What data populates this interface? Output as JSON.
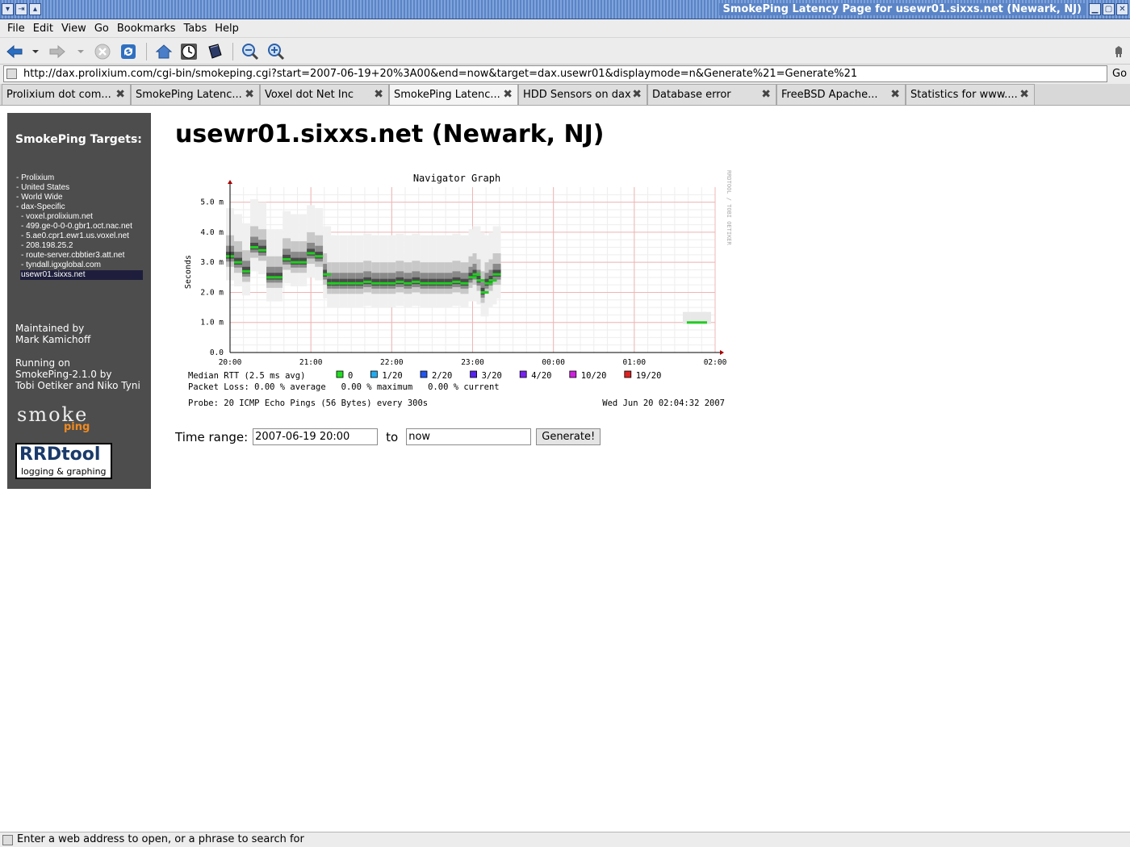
{
  "window": {
    "title": "SmokePing Latency Page for usewr01.sixxs.net (Newark, NJ)"
  },
  "menu": [
    "File",
    "Edit",
    "View",
    "Go",
    "Bookmarks",
    "Tabs",
    "Help"
  ],
  "url": {
    "value": "http://dax.prolixium.com/cgi-bin/smokeping.cgi?start=2007-06-19+20%3A00&end=now&target=dax.usewr01&displaymode=n&Generate%21=Generate%21",
    "go_label": "Go"
  },
  "tabs": [
    {
      "label": "Prolixium dot com..."
    },
    {
      "label": "SmokePing Latenc..."
    },
    {
      "label": "Voxel dot Net Inc"
    },
    {
      "label": "SmokePing Latenc..."
    },
    {
      "label": "HDD Sensors on dax"
    },
    {
      "label": "Database error"
    },
    {
      "label": "FreeBSD Apache..."
    },
    {
      "label": "Statistics for www...."
    }
  ],
  "sidebar": {
    "title": "SmokePing Targets:",
    "targets": [
      "- Prolixium",
      "- United States",
      "- World Wide",
      "- dax-Specific",
      "- voxel.prolixium.net",
      "- 499.ge-0-0-0.gbr1.oct.nac.net",
      "- 5.ae0.cpr1.ewr1.us.voxel.net",
      "- 208.198.25.2",
      "- route-server.cbbtier3.att.net",
      "- tyndall.igxglobal.com",
      "usewr01.sixxs.net"
    ],
    "maintained_label": "Maintained by",
    "maintainer": "Mark Kamichoff",
    "running_label": "Running on",
    "version": "SmokePing-2.1.0 by",
    "authors": "Tobi Oetiker and Niko Tyni",
    "smoke_logo_top": "smoke",
    "smoke_logo_bottom": "ping",
    "rrd_logo_big": "RRDtool",
    "rrd_logo_small": "logging & graphing"
  },
  "page": {
    "heading": "usewr01.sixxs.net (Newark, NJ)"
  },
  "chart_data": {
    "type": "line",
    "title": "Navigator Graph",
    "ylabel": "Seconds",
    "watermark": "RRDTOOL / TOBI OETIKER",
    "x_ticks": [
      "20:00",
      "21:00",
      "22:00",
      "23:00",
      "00:00",
      "01:00",
      "02:00"
    ],
    "y_ticks": [
      "0.0",
      "1.0 m",
      "2.0 m",
      "3.0 m",
      "4.0 m",
      "5.0 m"
    ],
    "ylim": [
      0,
      5.5
    ],
    "xlim_hours": [
      20,
      26
    ],
    "median_series": {
      "name": "Median RTT",
      "x": [
        20.0,
        20.1,
        20.2,
        20.3,
        20.4,
        20.5,
        20.6,
        20.7,
        20.8,
        20.9,
        21.0,
        21.1,
        21.2,
        21.25,
        21.3,
        21.4,
        21.5,
        21.6,
        21.7,
        21.8,
        21.9,
        22.0,
        22.1,
        22.2,
        22.3,
        22.4,
        22.5,
        22.6,
        22.7,
        22.8,
        22.9,
        23.0,
        23.05,
        23.1,
        23.15,
        23.2,
        23.25,
        23.3
      ],
      "values": [
        3.2,
        3.0,
        2.7,
        3.5,
        3.4,
        2.5,
        2.5,
        3.1,
        3.0,
        3.0,
        3.3,
        3.2,
        2.6,
        2.3,
        2.3,
        2.3,
        2.3,
        2.3,
        2.35,
        2.3,
        2.3,
        2.3,
        2.35,
        2.3,
        2.35,
        2.3,
        2.3,
        2.3,
        2.3,
        2.35,
        2.3,
        2.5,
        2.6,
        2.4,
        2.0,
        2.3,
        2.4,
        2.6
      ]
    },
    "late_series": {
      "x": [
        25.65,
        25.75,
        25.85,
        25.9
      ],
      "values": [
        1.0,
        1.0,
        1.0,
        1.0
      ]
    },
    "legend": {
      "median_label": "Median RTT (2.5 ms avg)",
      "items": [
        {
          "label": "0",
          "color": "#22dd22"
        },
        {
          "label": "1/20",
          "color": "#22aaee"
        },
        {
          "label": "2/20",
          "color": "#2255ee"
        },
        {
          "label": "3/20",
          "color": "#5522ee"
        },
        {
          "label": "4/20",
          "color": "#7722ee"
        },
        {
          "label": "10/20",
          "color": "#cc22dd"
        },
        {
          "label": "19/20",
          "color": "#dd2222"
        }
      ]
    },
    "packet_loss": "Packet Loss: 0.00 % average   0.00 % maximum   0.00 % current",
    "probe": "Probe: 20 ICMP Echo Pings (56 Bytes) every 300s",
    "timestamp": "Wed Jun 20 02:04:32 2007"
  },
  "form": {
    "time_range_label": "Time range:",
    "start_value": "2007-06-19 20:00",
    "to_label": "to",
    "end_value": "now",
    "generate_label": "Generate!"
  },
  "status": {
    "text": "Enter a web address to open, or a phrase to search for"
  }
}
